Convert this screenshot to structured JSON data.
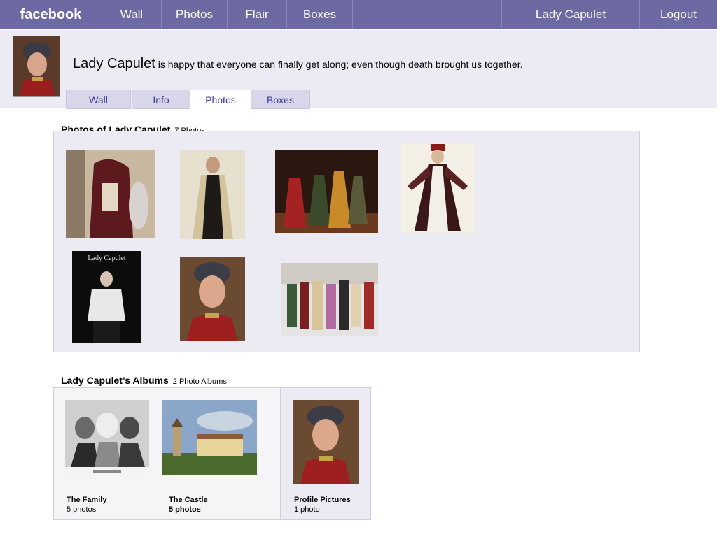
{
  "nav": {
    "brand": "facebook",
    "items": [
      "Wall",
      "Photos",
      "Flair",
      "Boxes"
    ],
    "user": "Lady Capulet",
    "logout": "Logout"
  },
  "profile": {
    "name": "Lady Capulet",
    "status": "is happy that everyone can finally get along; even though death brought us together."
  },
  "tabs": [
    "Wall",
    "Info",
    "Photos",
    "Boxes"
  ],
  "active_tab": "Photos",
  "photos_section": {
    "title": "Photos of Lady Capulet",
    "count": "7 Photos",
    "photo_caption_text": "Lady Capulet"
  },
  "albums_section": {
    "title": "Lady Capulet’s Albums",
    "count": "2 Photo Albums",
    "albums": [
      {
        "title": "The Family",
        "count": "5 photos"
      },
      {
        "title": "The Castle",
        "count": "5 photos"
      },
      {
        "title": "Profile Pictures",
        "count": "1 photo"
      }
    ]
  },
  "colors": {
    "topbar": "#6d6aa3",
    "tab_text": "#3b3b98",
    "panel": "#eceaf2"
  }
}
